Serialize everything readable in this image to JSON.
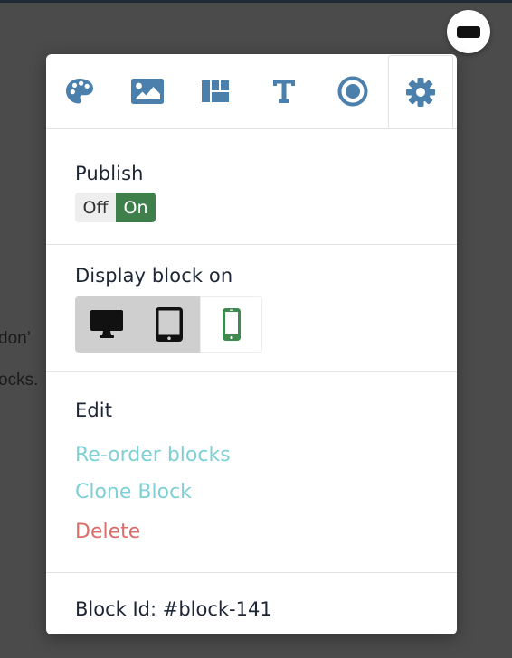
{
  "background": {
    "line1": "don’",
    "line2": "ocks."
  },
  "window": {
    "minimize_icon": "minimize-icon"
  },
  "tabs": [
    {
      "name": "palette",
      "icon": "palette-icon"
    },
    {
      "name": "image",
      "icon": "image-icon"
    },
    {
      "name": "layout",
      "icon": "layout-icon"
    },
    {
      "name": "text",
      "icon": "text-icon"
    },
    {
      "name": "circle",
      "icon": "circle-icon"
    },
    {
      "name": "settings",
      "icon": "gear-icon",
      "active": true
    }
  ],
  "publish": {
    "title": "Publish",
    "off_label": "Off",
    "on_label": "On",
    "state": "On"
  },
  "display": {
    "title": "Display block on",
    "devices": [
      {
        "name": "desktop",
        "icon": "desktop-icon",
        "selected": false
      },
      {
        "name": "tablet",
        "icon": "tablet-icon",
        "selected": false
      },
      {
        "name": "mobile",
        "icon": "mobile-icon",
        "selected": true
      }
    ]
  },
  "edit": {
    "title": "Edit",
    "reorder": "Re-order blocks",
    "clone": "Clone Block",
    "delete": "Delete"
  },
  "block_id": {
    "text": "Block Id: #block-141"
  },
  "colors": {
    "icon_blue": "#4a80ab",
    "on_green": "#3f7f4c",
    "link_teal": "#7fd0d4",
    "delete_red": "#dc6e6a",
    "mobile_green": "#3f8a4f"
  }
}
